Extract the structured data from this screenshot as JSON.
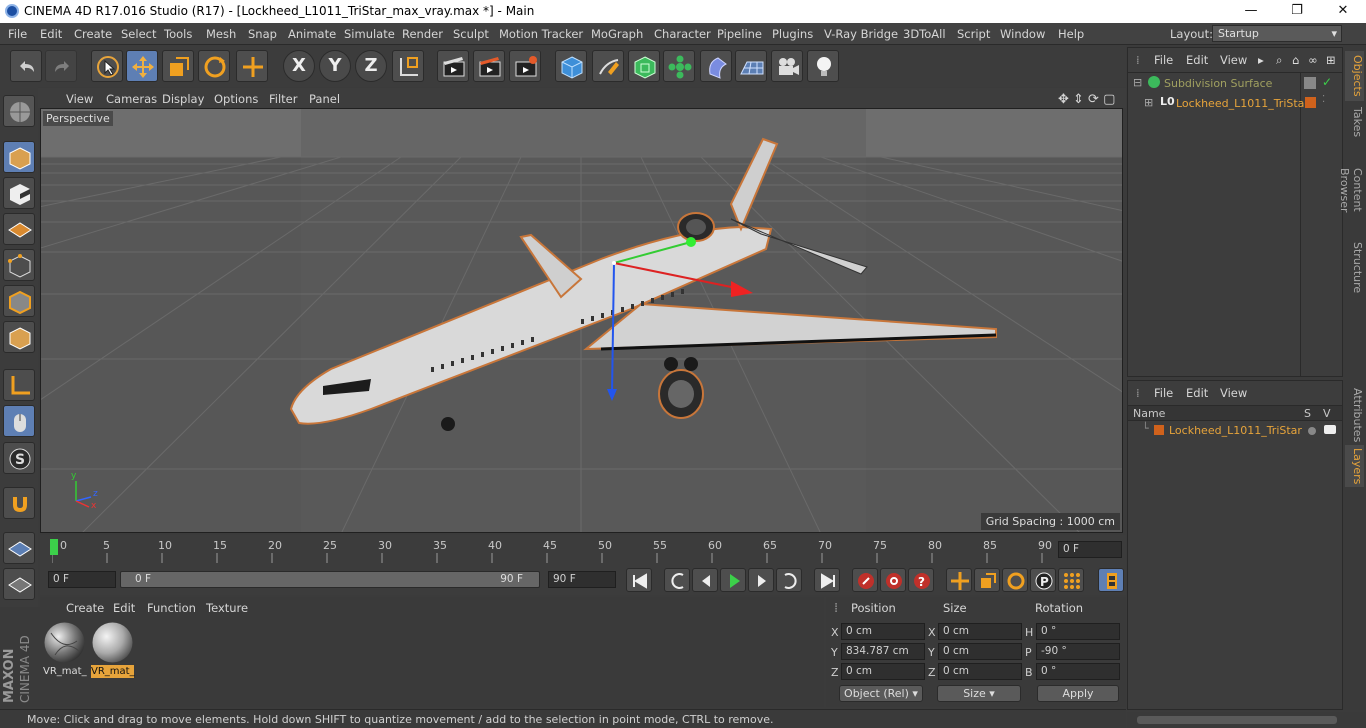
{
  "window": {
    "title": "CINEMA 4D R17.016 Studio (R17) - [Lockheed_L1011_TriStar_max_vray.max *] - Main",
    "minimize": "—",
    "restore": "❐",
    "close": "✕"
  },
  "menu": [
    "File",
    "Edit",
    "Create",
    "Select",
    "Tools",
    "Mesh",
    "Snap",
    "Animate",
    "Simulate",
    "Render",
    "Sculpt",
    "Motion Tracker",
    "MoGraph",
    "Character",
    "Pipeline",
    "Plugins",
    "V-Ray Bridge",
    "3DToAll",
    "Script",
    "Window",
    "Help"
  ],
  "layout": {
    "label": "Layout:",
    "value": "Startup"
  },
  "toolbar": {
    "x_label": "X",
    "y_label": "Y",
    "z_label": "Z"
  },
  "viewport": {
    "menu": [
      "View",
      "Cameras",
      "Display",
      "Options",
      "Filter",
      "Panel"
    ],
    "camera_label": "Perspective",
    "grid_spacing": "Grid Spacing : 1000 cm",
    "axis_x": "x",
    "axis_y": "y",
    "axis_z": "z"
  },
  "timeline": {
    "ticks": [
      "0",
      "5",
      "10",
      "15",
      "20",
      "25",
      "30",
      "35",
      "40",
      "45",
      "50",
      "55",
      "60",
      "65",
      "70",
      "75",
      "80",
      "85",
      "90"
    ],
    "current_frame": "0 F",
    "start_field": "0 F",
    "range_start": "0 F",
    "range_end": "90 F",
    "end_field": "90 F"
  },
  "materials": {
    "menu": [
      "Create",
      "Edit",
      "Function",
      "Texture"
    ],
    "items": [
      {
        "label": "VR_mat_",
        "selected": false
      },
      {
        "label": "VR_mat_",
        "selected": true
      }
    ]
  },
  "coordinates": {
    "headers": {
      "position": "Position",
      "size": "Size",
      "rotation": "Rotation"
    },
    "rows": [
      {
        "pos_axis": "X",
        "pos_val": "0 cm",
        "size_axis": "X",
        "size_val": "0 cm",
        "rot_axis": "H",
        "rot_val": "0 °"
      },
      {
        "pos_axis": "Y",
        "pos_val": "834.787 cm",
        "size_axis": "Y",
        "size_val": "0 cm",
        "rot_axis": "P",
        "rot_val": "-90 °"
      },
      {
        "pos_axis": "Z",
        "pos_val": "0 cm",
        "size_axis": "Z",
        "size_val": "0 cm",
        "rot_axis": "B",
        "rot_val": "0 °"
      }
    ],
    "mode_select": "Object (Rel)",
    "size_select": "Size",
    "apply": "Apply"
  },
  "branding": {
    "maxon": "MAXON",
    "product": "CINEMA 4D"
  },
  "status": "Move: Click and drag to move elements. Hold down SHIFT to quantize movement / add to the selection in point mode, CTRL to remove.",
  "objects_panel": {
    "menu": [
      "File",
      "Edit",
      "View"
    ],
    "items": [
      {
        "name": "Subdivision Surface",
        "depth": 0
      },
      {
        "name": "Lockheed_L1011_TriStar",
        "depth": 1
      }
    ]
  },
  "layers_panel": {
    "menu": [
      "File",
      "Edit",
      "View"
    ],
    "col_name": "Name",
    "col_s": "S",
    "col_v": "V",
    "items": [
      {
        "name": "Lockheed_L1011_TriStar"
      }
    ]
  },
  "side_tabs": [
    "Objects",
    "Takes",
    "Content Browser",
    "Structure",
    "Attributes",
    "Layers"
  ],
  "colors": {
    "accent": "#e7a43b",
    "active_tool": "#5e7fb4",
    "layer_swatch": "#d0621c"
  }
}
